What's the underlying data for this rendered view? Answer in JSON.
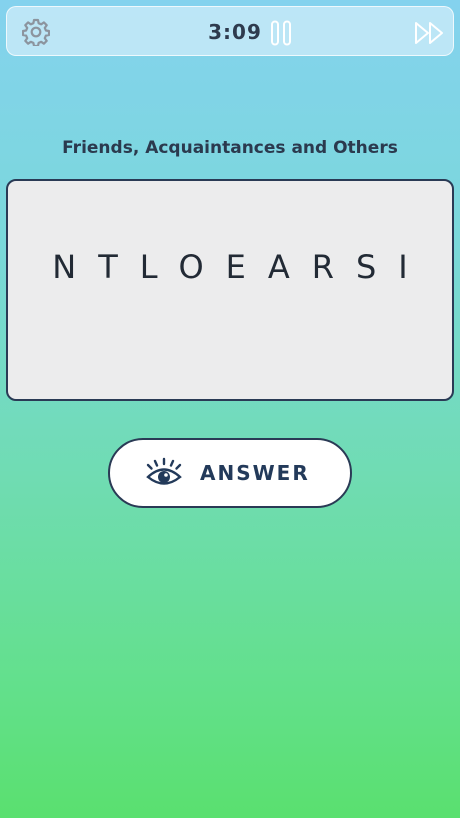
{
  "topbar": {
    "settings_icon": "gear-icon",
    "timer": "3:09",
    "pause_icon": "pause-icon",
    "skip_icon": "fast-forward-icon"
  },
  "puzzle": {
    "category": "Friends, Acquaintances and Others",
    "letters": "NTLOEARSI"
  },
  "answer_button": {
    "icon": "eye-icon",
    "label": "ANSWER"
  },
  "colors": {
    "gradient_top": "#84d2ee",
    "gradient_bottom": "#5ae06f",
    "text_dark": "#2b3a4e",
    "card_bg": "#ececed",
    "border": "#2a3a55"
  }
}
